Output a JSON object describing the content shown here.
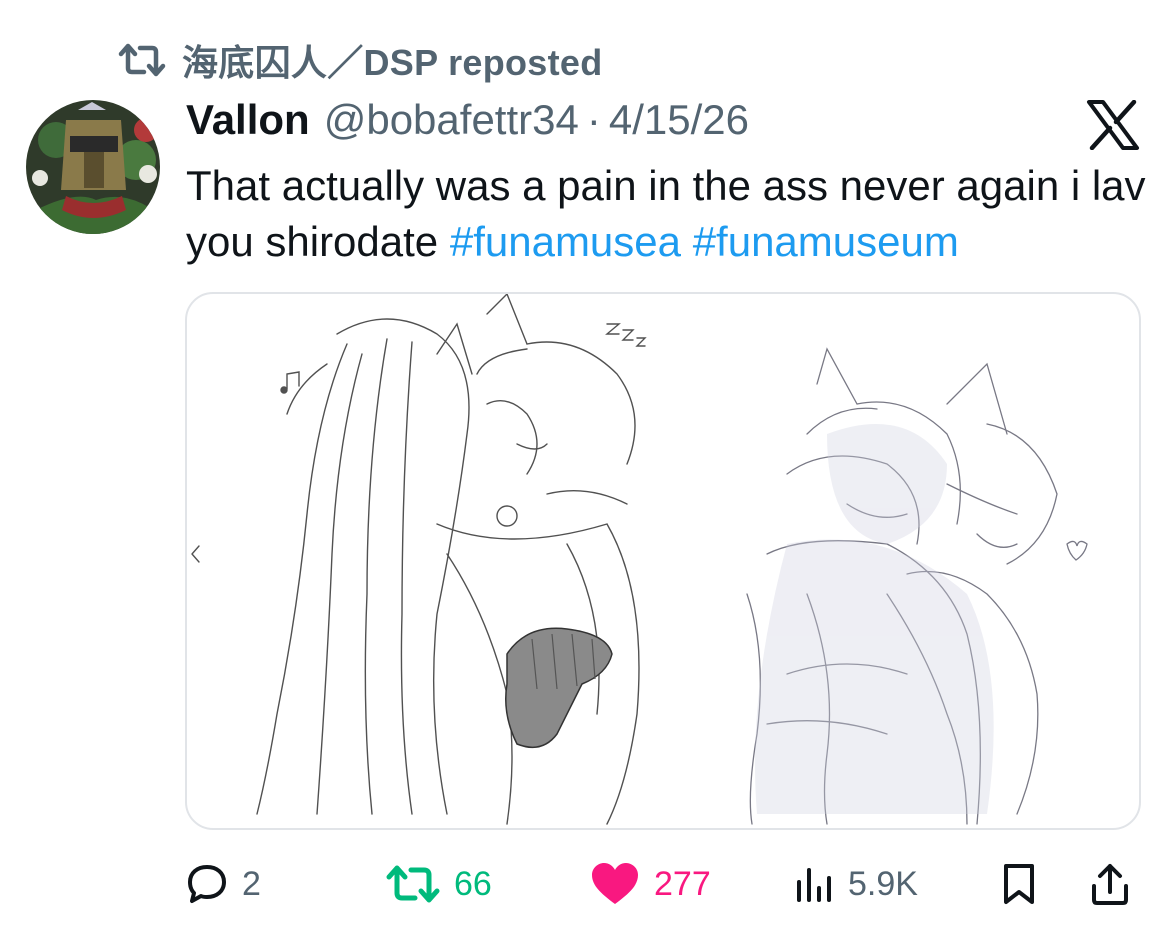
{
  "repost": {
    "icon": "retweet-icon",
    "text": "海底囚人／DSP reposted"
  },
  "tweet": {
    "display_name": "Vallon",
    "handle": "@bobafettr34",
    "separator": "·",
    "date": "4/15/26",
    "text_plain": "That actually was a pain in the ass never again i lav you shirodate ",
    "hashtags": [
      "#funamusea",
      "#funamuseum"
    ],
    "platform_logo": "x-logo-icon"
  },
  "media": {
    "description_icon": "sketch-artwork-image"
  },
  "actions": {
    "replies": "2",
    "retweets": "66",
    "likes": "277",
    "views": "5.9K"
  },
  "colors": {
    "text": "#0f1419",
    "secondary": "#536471",
    "hashtag": "#1d9bf0",
    "retweet": "#00ba7c",
    "like": "#f91880",
    "border": "#e1e4e8"
  }
}
